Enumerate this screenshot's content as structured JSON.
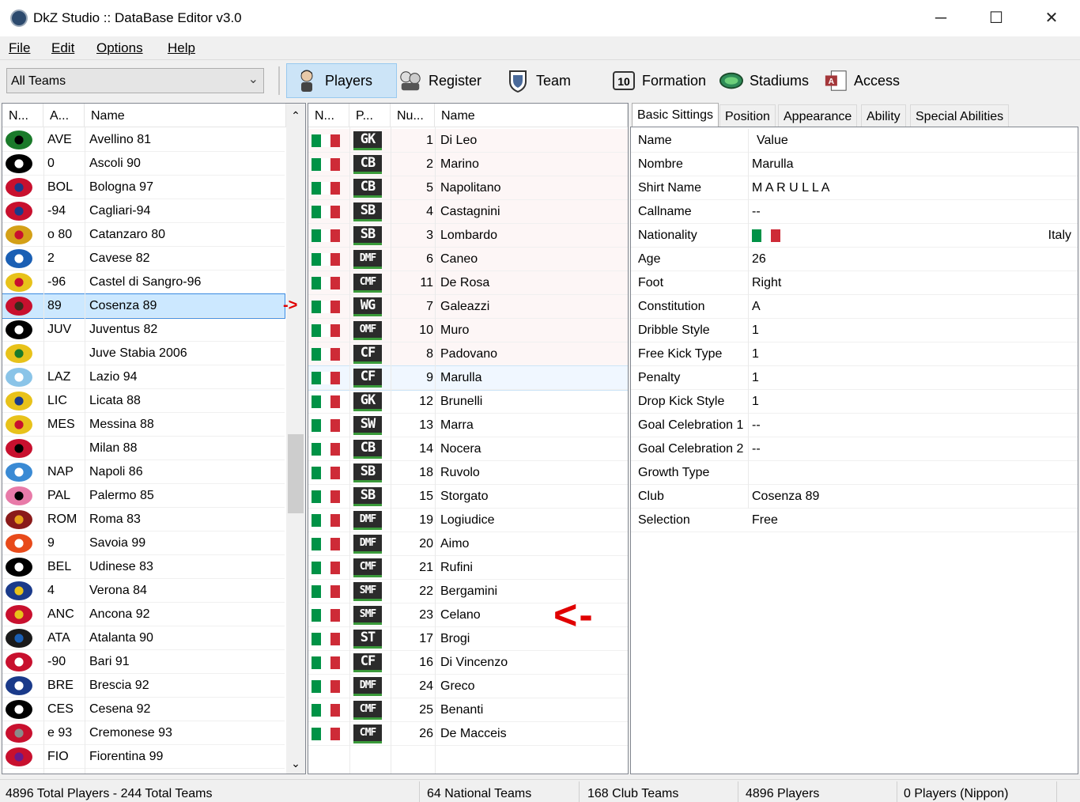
{
  "window": {
    "title": "DkZ Studio :: DataBase Editor v3.0",
    "minimize": "─",
    "maximize": "☐",
    "close": "✕"
  },
  "menu": [
    "File",
    "Edit",
    "Options",
    "Help"
  ],
  "toolbar": {
    "team_filter": "All Teams",
    "buttons": [
      {
        "label": "Players",
        "icon": "player-icon"
      },
      {
        "label": "Register",
        "icon": "register-icon"
      },
      {
        "label": "Team",
        "icon": "team-icon"
      },
      {
        "label": "Formation",
        "icon": "formation-icon"
      },
      {
        "label": "Stadiums",
        "icon": "stadium-icon"
      },
      {
        "label": "Access",
        "icon": "access-icon"
      }
    ]
  },
  "teams": {
    "headers": [
      "N...",
      "A...",
      "Name"
    ],
    "rows": [
      {
        "abbr": "AVE",
        "name": "Avellino 81",
        "colors": [
          "#1a7a2a",
          "#000000"
        ]
      },
      {
        "abbr": "0",
        "name": "Ascoli 90",
        "colors": [
          "#000000",
          "#ffffff"
        ]
      },
      {
        "abbr": "BOL",
        "name": "Bologna 97",
        "colors": [
          "#c8102e",
          "#1a3a8a"
        ]
      },
      {
        "abbr": "-94",
        "name": "Cagliari-94",
        "colors": [
          "#c8102e",
          "#1a3a8a"
        ]
      },
      {
        "abbr": "o 80",
        "name": "Catanzaro 80",
        "colors": [
          "#d4a017",
          "#c8102e"
        ]
      },
      {
        "abbr": "2",
        "name": "Cavese 82",
        "colors": [
          "#1a5fb4",
          "#ffffff"
        ]
      },
      {
        "abbr": "-96",
        "name": "Castel di Sangro-96",
        "colors": [
          "#e8c21a",
          "#c8102e"
        ]
      },
      {
        "abbr": "89",
        "name": "Cosenza 89",
        "colors": [
          "#c8102e",
          "#3a2a1a"
        ]
      },
      {
        "abbr": "JUV",
        "name": "Juventus 82",
        "colors": [
          "#000000",
          "#ffffff"
        ]
      },
      {
        "abbr": "",
        "name": "Juve Stabia 2006",
        "colors": [
          "#e8c21a",
          "#1a7a2a"
        ]
      },
      {
        "abbr": "LAZ",
        "name": "Lazio 94",
        "colors": [
          "#8ac4e8",
          "#ffffff"
        ]
      },
      {
        "abbr": "LIC",
        "name": "Licata 88",
        "colors": [
          "#e8c21a",
          "#1a3a8a"
        ]
      },
      {
        "abbr": "MES",
        "name": "Messina 88",
        "colors": [
          "#e8c21a",
          "#c8102e"
        ]
      },
      {
        "abbr": "",
        "name": "Milan 88",
        "colors": [
          "#c8102e",
          "#000000"
        ]
      },
      {
        "abbr": "NAP",
        "name": "Napoli 86",
        "colors": [
          "#3a8ad4",
          "#ffffff"
        ]
      },
      {
        "abbr": "PAL",
        "name": "Palermo 85",
        "colors": [
          "#e87aa8",
          "#000000"
        ]
      },
      {
        "abbr": "ROM",
        "name": "Roma 83",
        "colors": [
          "#8a1a1a",
          "#e8a01a"
        ]
      },
      {
        "abbr": "9",
        "name": "Savoia 99",
        "colors": [
          "#e84a1a",
          "#ffffff"
        ]
      },
      {
        "abbr": "BEL",
        "name": "Udinese 83",
        "colors": [
          "#000000",
          "#ffffff"
        ]
      },
      {
        "abbr": "4",
        "name": "Verona 84",
        "colors": [
          "#1a3a8a",
          "#e8c21a"
        ]
      },
      {
        "abbr": "ANC",
        "name": "Ancona 92",
        "colors": [
          "#c8102e",
          "#e8c21a"
        ]
      },
      {
        "abbr": "ATA",
        "name": "Atalanta 90",
        "colors": [
          "#1a1a1a",
          "#1a5fb4"
        ]
      },
      {
        "abbr": "-90",
        "name": "Bari 91",
        "colors": [
          "#c8102e",
          "#ffffff"
        ]
      },
      {
        "abbr": "BRE",
        "name": "Brescia 92",
        "colors": [
          "#1a3a8a",
          "#ffffff"
        ]
      },
      {
        "abbr": "CES",
        "name": "Cesena 92",
        "colors": [
          "#000000",
          "#ffffff"
        ]
      },
      {
        "abbr": "e 93",
        "name": "Cremonese 93",
        "colors": [
          "#c8102e",
          "#8a8a8a"
        ]
      },
      {
        "abbr": "FIO",
        "name": "Fiorentina 99",
        "colors": [
          "#c8102e",
          "#6a1a8a"
        ]
      }
    ],
    "selected_index": 7
  },
  "players": {
    "headers": [
      "N...",
      "P...",
      "Nu...",
      "Name"
    ],
    "rows": [
      {
        "pos": "GK",
        "num": "1",
        "name": "Di Leo"
      },
      {
        "pos": "CB",
        "num": "2",
        "name": "Marino"
      },
      {
        "pos": "CB",
        "num": "5",
        "name": "Napolitano"
      },
      {
        "pos": "SB",
        "num": "4",
        "name": "Castagnini"
      },
      {
        "pos": "SB",
        "num": "3",
        "name": "Lombardo"
      },
      {
        "pos": "DMF",
        "num": "6",
        "name": "Caneo"
      },
      {
        "pos": "CMF",
        "num": "11",
        "name": "De Rosa"
      },
      {
        "pos": "WG",
        "num": "7",
        "name": "Galeazzi"
      },
      {
        "pos": "OMF",
        "num": "10",
        "name": "Muro"
      },
      {
        "pos": "CF",
        "num": "8",
        "name": "Padovano"
      },
      {
        "pos": "CF",
        "num": "9",
        "name": "Marulla"
      },
      {
        "pos": "GK",
        "num": "12",
        "name": "Brunelli"
      },
      {
        "pos": "SW",
        "num": "13",
        "name": "Marra"
      },
      {
        "pos": "CB",
        "num": "14",
        "name": "Nocera"
      },
      {
        "pos": "SB",
        "num": "18",
        "name": "Ruvolo"
      },
      {
        "pos": "SB",
        "num": "15",
        "name": "Storgato"
      },
      {
        "pos": "DMF",
        "num": "19",
        "name": "Logiudice"
      },
      {
        "pos": "DMF",
        "num": "20",
        "name": "Aimo"
      },
      {
        "pos": "CMF",
        "num": "21",
        "name": "Rufini"
      },
      {
        "pos": "SMF",
        "num": "22",
        "name": "Bergamini"
      },
      {
        "pos": "SMF",
        "num": "23",
        "name": "Celano"
      },
      {
        "pos": "ST",
        "num": "17",
        "name": "Brogi"
      },
      {
        "pos": "CF",
        "num": "16",
        "name": "Di Vincenzo"
      },
      {
        "pos": "DMF",
        "num": "24",
        "name": "Greco"
      },
      {
        "pos": "CMF",
        "num": "25",
        "name": "Benanti"
      },
      {
        "pos": "CMF",
        "num": "26",
        "name": "De Macceis"
      }
    ],
    "selected_index": 10,
    "flag_colors": [
      "#009246",
      "#ffffff",
      "#ce2b37"
    ]
  },
  "tabs": [
    "Basic Sittings",
    "Position",
    "Appearance",
    "Ability",
    "Special Abilities"
  ],
  "details": {
    "headers": [
      "Name",
      "Value"
    ],
    "rows": [
      {
        "key": "Nombre",
        "value": "Marulla"
      },
      {
        "key": "Shirt Name",
        "value": "M A R U L L A"
      },
      {
        "key": "Callname",
        "value": "--"
      },
      {
        "key": "Nationality",
        "value": "",
        "flag": true,
        "extra": "Italy"
      },
      {
        "key": "Age",
        "value": "26"
      },
      {
        "key": "Foot",
        "value": "Right"
      },
      {
        "key": "Constitution",
        "value": "A"
      },
      {
        "key": "Dribble Style",
        "value": "1"
      },
      {
        "key": "Free Kick Type",
        "value": "1"
      },
      {
        "key": "Penalty",
        "value": "1"
      },
      {
        "key": "Drop Kick Style",
        "value": "1"
      },
      {
        "key": "Goal Celebration 1",
        "value": "--"
      },
      {
        "key": "Goal Celebration 2",
        "value": "--"
      },
      {
        "key": "Growth Type",
        "value": ""
      },
      {
        "key": "Club",
        "value": "Cosenza 89"
      },
      {
        "key": "Selection",
        "value": "Free"
      }
    ]
  },
  "status": [
    "4896 Total Players  -  244 Total Teams",
    "64 National Teams",
    "168 Club Teams",
    "4896 Players",
    "0 Players (Nippon)"
  ],
  "annotations": {
    "small_arrow": "->",
    "big_arrow": "<-"
  }
}
